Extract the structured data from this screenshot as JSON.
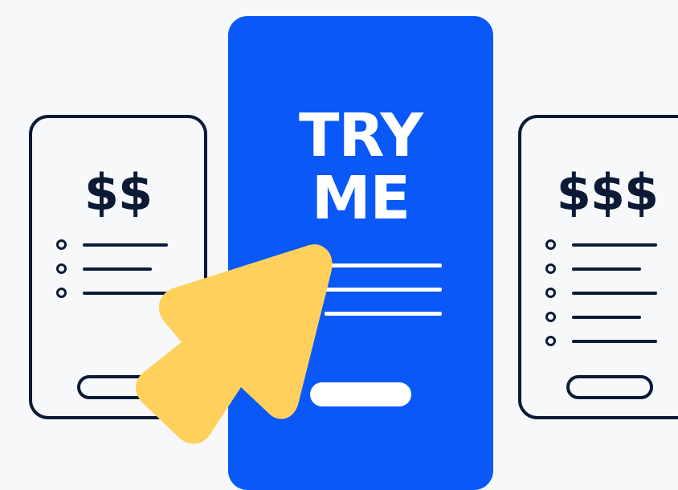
{
  "cards": {
    "left": {
      "price": "$$",
      "features": 3
    },
    "center": {
      "line1": "TRY",
      "line2": "ME",
      "features": 3
    },
    "right": {
      "price": "$$$",
      "features": 5
    }
  },
  "colors": {
    "background": "#f6f8fa",
    "ink": "#0c1a36",
    "accent": "#0a58f7",
    "cursor": "#ffd15c"
  },
  "icons": {
    "cursor": "pointer-arrow-icon",
    "bullet": "circle-bullet-icon"
  }
}
